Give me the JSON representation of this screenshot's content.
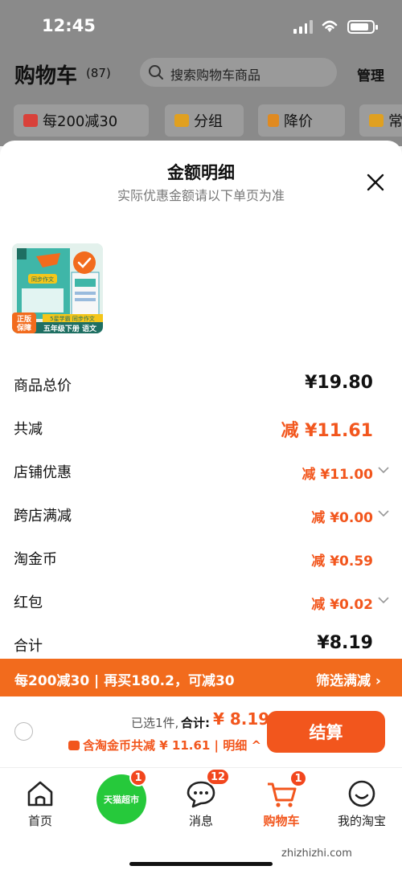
{
  "status": {
    "time": "12:45"
  },
  "header": {
    "title": "购物车",
    "count": "(87)",
    "search_placeholder": "搜索购物车商品",
    "manage": "管理",
    "chips": [
      {
        "label": "每200减30",
        "color": "#d9413a"
      },
      {
        "label": "分组",
        "color": "#e0a020"
      },
      {
        "label": "降价",
        "color": "#e08a20"
      },
      {
        "label": "常",
        "color": "#e0a020"
      }
    ]
  },
  "sheet": {
    "title": "金额明细",
    "subtitle": "实际优惠金额请以下单页为准",
    "product": {
      "badge_line1": "正版",
      "badge_line2": "保障",
      "bottom_text": "五年级下册 语文",
      "ribbon_text": "5星学霸 同步作文",
      "logo_text": "同步作文"
    },
    "rows": [
      {
        "label": "商品总价",
        "value": "¥19.80"
      },
      {
        "label": "共减",
        "value": "减 ¥11.61"
      },
      {
        "label": "店铺优惠",
        "value": "减 ¥11.00"
      },
      {
        "label": "跨店满减",
        "value": "减 ¥0.00"
      },
      {
        "label": "淘金币",
        "value": "减 ¥0.59"
      },
      {
        "label": "红包",
        "value": "减 ¥0.02"
      },
      {
        "label": "合计",
        "value": "¥8.19"
      }
    ]
  },
  "promo": {
    "left": "每200减30 | 再买180.2，可减30",
    "right": "筛选满减 ›"
  },
  "checkout": {
    "selected": "已选1件,",
    "total_label": "合计:",
    "total_value": "¥ 8.19",
    "discount": "含淘金币共减 ¥ 11.61 | 明细 ^",
    "button": "结算"
  },
  "tabbar": {
    "tabs": [
      {
        "label": "首页"
      },
      {
        "label": "天猫超市",
        "badge": "1"
      },
      {
        "label": "消息",
        "badge": "12"
      },
      {
        "label": "购物车",
        "badge": "1"
      },
      {
        "label": "我的淘宝"
      }
    ]
  },
  "watermark": "zhizhizhi.com",
  "colors": {
    "accent": "#f2561d",
    "promo_bar": "#f26b1d",
    "tmall_green": "#26c93b"
  }
}
